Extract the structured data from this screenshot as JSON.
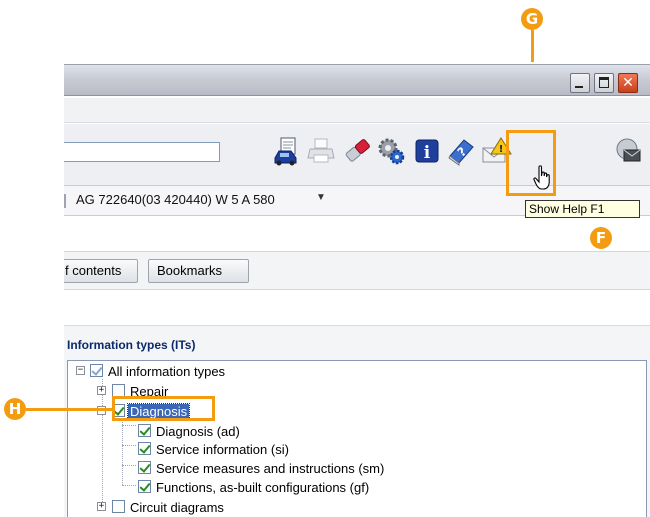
{
  "window": {
    "buttons": {
      "minimize": "minimize",
      "maximize": "maximize",
      "close": "close"
    }
  },
  "toolbar": {
    "icons": [
      "car-print-icon",
      "printer-icon",
      "eraser-icon",
      "settings-gears-icon",
      "info-icon",
      "help-book-icon",
      "warning-mail-icon",
      "network-mail-icon"
    ]
  },
  "vehicle": {
    "label": "AG 722640(03 420440) W 5 A 580"
  },
  "tabs": {
    "toc_label": "f contents",
    "bookmarks_label": "Bookmarks"
  },
  "info_types": {
    "title": "Information types (ITs)",
    "root": "All information types",
    "repair": "Repair",
    "diagnosis": "Diagnosis",
    "diagnosis_ad": "Diagnosis (ad)",
    "service_information": "Service information (si)",
    "service_measures": "Service measures and instructions (sm)",
    "functions": "Functions, as-built configurations (gf)",
    "circuit_diagrams": "Circuit diagrams"
  },
  "tooltip": {
    "text": "Show Help  F1"
  },
  "callouts": {
    "g": "G",
    "f": "F",
    "h": "H",
    "color": "#f39c12"
  }
}
